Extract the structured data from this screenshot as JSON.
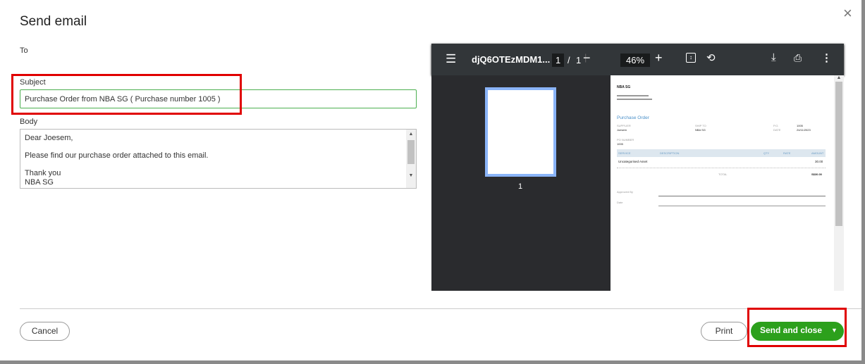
{
  "dialog": {
    "title": "Send email",
    "close_icon": "×"
  },
  "form": {
    "to_label": "To",
    "subject_label": "Subject",
    "subject_value": "Purchase Order from NBA SG ( Purchase number 1005 )",
    "body_label": "Body",
    "body_lines": [
      "Dear Joesem,",
      "Please find our purchase order attached to this email.",
      "Thank you",
      "NBA SG"
    ]
  },
  "viewer": {
    "filename": "djQ6OTEzMDM1...",
    "page_current": "1",
    "page_sep": "/",
    "page_total": "1",
    "zoom": "46%",
    "thumb_label": "1",
    "doc": {
      "company": "NBA SG",
      "heading": "Purchase Order",
      "supplier_label": "SUPPLIER",
      "supplier": "Joesem",
      "shipto_label": "SHIP TO",
      "shipto": "NBA SG",
      "po_label": "P.O.",
      "po": "1005",
      "date_label": "DATE",
      "date": "24/11/2023",
      "ponum_label": "PO NUMBER",
      "ponum": "1005",
      "cols": [
        "SERVICE",
        "DESCRIPTION",
        "QTY",
        "RATE",
        "AMOUNT"
      ],
      "row_service": "Uncategorised Asset",
      "row_amount": "30.00",
      "total_label": "TOTAL",
      "total": "S$30.00",
      "approved_label": "Approved By",
      "date2_label": "Date"
    }
  },
  "footer": {
    "cancel": "Cancel",
    "print": "Print",
    "send": "Send and close"
  },
  "colors": {
    "accent": "#2ca01c",
    "highlight": "#e00000"
  }
}
